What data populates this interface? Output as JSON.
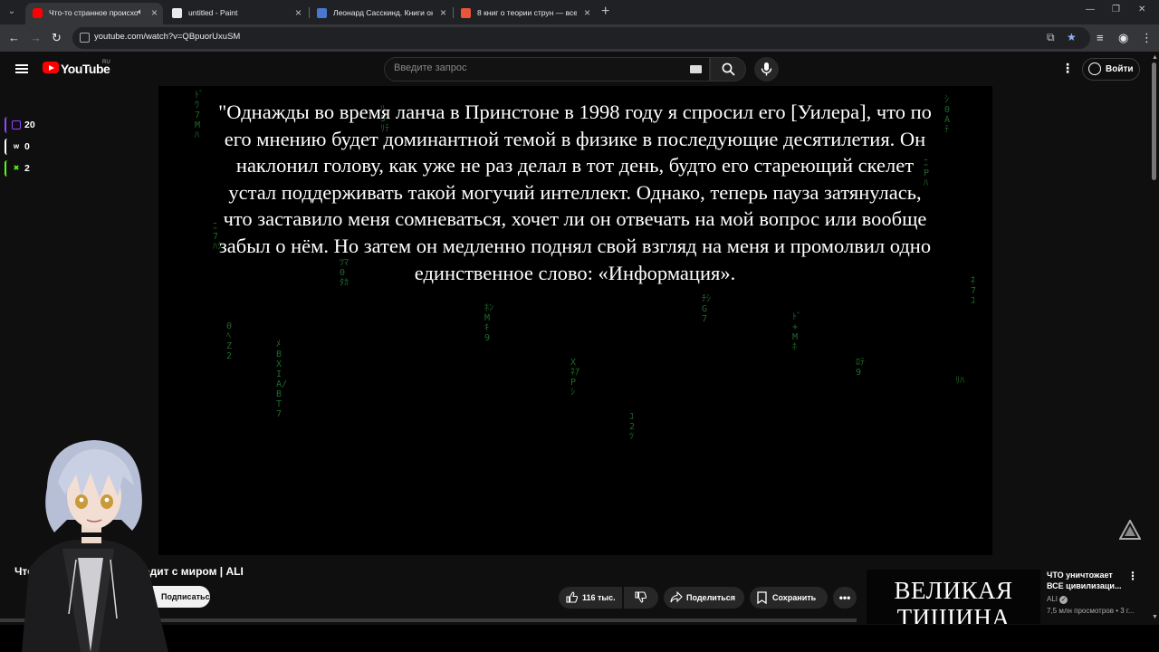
{
  "browser": {
    "tabs": [
      {
        "title": "Что-то странное происходит с миром | ALI",
        "active": true,
        "audio": true
      },
      {
        "title": "untitled - Paint",
        "active": false
      },
      {
        "title": "Леонард Сасскинд. Книги онлайн",
        "active": false
      },
      {
        "title": "8 книг о теории струн — все от",
        "active": false
      }
    ],
    "url": "youtube.com/watch?v=QBpuorUxuSM"
  },
  "youtube": {
    "logo_text": "YouTube",
    "country": "RU",
    "search_placeholder": "Введите запрос",
    "signin_label": "Войти"
  },
  "video": {
    "quote": "\"Однажды во время ланча в Принстоне в 1998 году я спросил его [Уилера], что по его мнению будет доминантной темой в физике в последующие десятилетия. Он наклонил голову, как уже не раз делал в тот день, будто его стареющий скелет устал поддерживать такой могучий интеллект. Однако, теперь пауза затянулась, что заставило меня сомневаться, хочет ли он отвечать на мой вопрос или вообще забыл о нём. Но затем он медленно поднял свой взгляд на меня и промолвил одно единственное слово: «Информация».",
    "rain_columns": [
      "ﾄﾞｳ7Mﾊ",
      "ﾆ7ﾊｸ",
      "0ﾍZ2",
      "ﾒBXIA/BT7",
      "ﾂﾏ0ﾀｶ",
      "ﾊ5ﾘﾃ",
      "ﾎﾝMｷ9",
      "XﾈｱPｼ",
      "ﾕ2ﾂ",
      "ﾁｼG7",
      "ﾄﾞ+Mﾎ",
      "ﾛﾃ9",
      "ﾆPﾊ",
      "ｼ0Aﾃ",
      "ﾘﾊ",
      "ﾈ7ﾕ"
    ]
  },
  "counters": [
    {
      "icon": "twitch-icon",
      "value": "20",
      "color": "#9146ff"
    },
    {
      "icon": "w-icon",
      "value": "0",
      "color": "#ffffff"
    },
    {
      "icon": "x-icon",
      "value": "2",
      "color": "#53fc18"
    }
  ],
  "video_info": {
    "title": "Что-то странное происходит с миром | ALI",
    "subscribe_label": "Подписаться",
    "likes": "116 тыс.",
    "share_label": "Поделиться",
    "save_label": "Сохранить"
  },
  "recommendation": {
    "thumb_text": "ВЕЛИКАЯ\nТИШИНА",
    "title": "ЧТО уничтожает ВСЕ цивилизаци...",
    "channel": "ALI",
    "meta": "7,5 млн просмотров • 3 г..."
  }
}
